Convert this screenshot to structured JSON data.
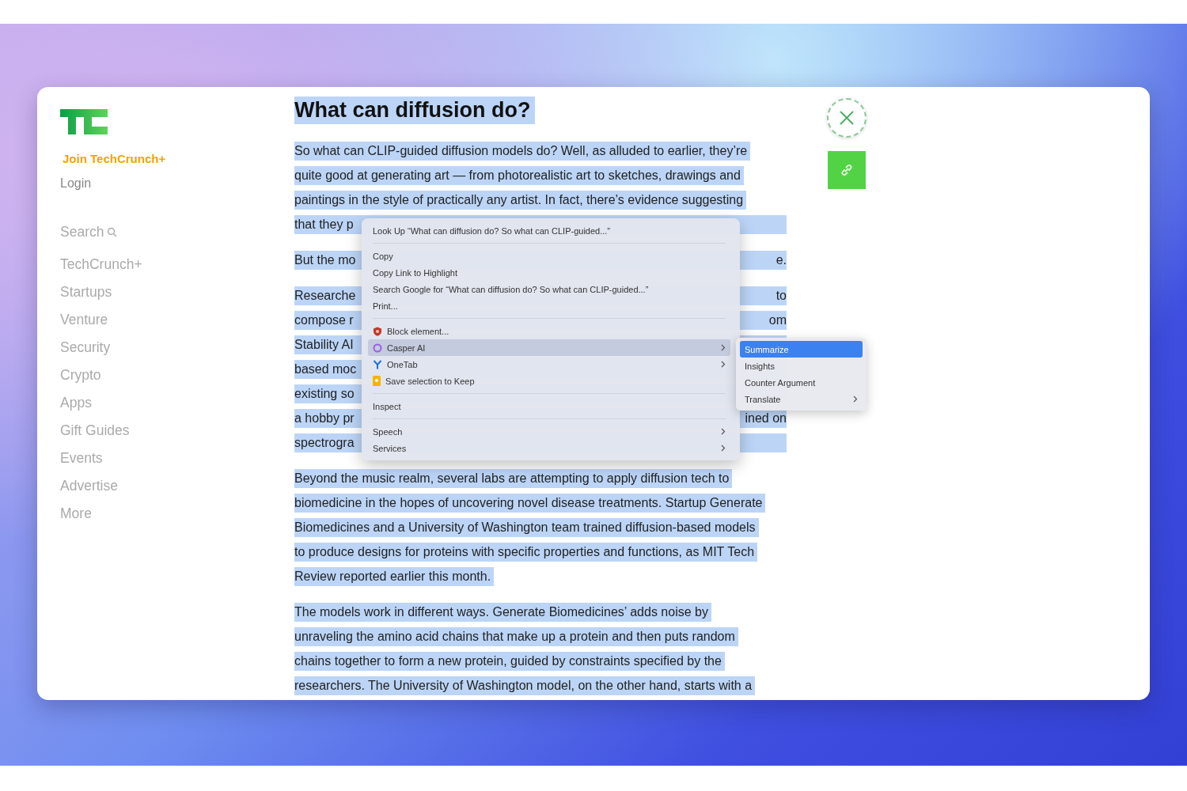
{
  "sidebar": {
    "join_link": "Join TechCrunch+",
    "login_link": "Login",
    "search_link": "Search",
    "items": [
      "TechCrunch+",
      "Startups",
      "Venture",
      "Security",
      "Crypto",
      "Apps",
      "Gift Guides",
      "Events",
      "Advertise",
      "More"
    ]
  },
  "article": {
    "heading": "What can diffusion do?",
    "paragraphs": [
      [
        {
          "kind": "full",
          "text": "So what can CLIP-guided diffusion models do? Well, as alluded to earlier, they’re"
        },
        {
          "kind": "full",
          "text": "quite good at generating art — from photorealistic art to sketches, drawings and"
        },
        {
          "kind": "full",
          "text": "paintings in the style of practically any artist. In fact, there’s evidence suggesting"
        },
        {
          "kind": "split",
          "start": "that they p"
        }
      ],
      [
        {
          "kind": "split",
          "start": "But the mo",
          "end": "e."
        }
      ],
      [
        {
          "kind": "split",
          "start": "Researche",
          "end": "to"
        },
        {
          "kind": "split",
          "start": "compose r",
          "end": "om"
        },
        {
          "kind": "split",
          "start": "Stability AI"
        },
        {
          "kind": "split",
          "start": "based moc"
        },
        {
          "kind": "split",
          "start": "existing so"
        },
        {
          "kind": "split",
          "start": "a hobby pr",
          "end": "ined on"
        },
        {
          "kind": "split",
          "start": "spectrogra"
        }
      ],
      [
        {
          "kind": "full",
          "text": "Beyond the music realm, several labs are attempting to apply diffusion tech to"
        },
        {
          "kind": "full",
          "text": "biomedicine in the hopes of uncovering novel disease treatments. Startup Generate"
        },
        {
          "kind": "full",
          "text": "Biomedicines and a University of Washington team trained diffusion-based models"
        },
        {
          "kind": "full",
          "text": "to produce designs for proteins with specific properties and functions, as MIT Tech"
        },
        {
          "kind": "full",
          "text": "Review reported earlier this month."
        }
      ],
      [
        {
          "kind": "full",
          "text": "The models work in different ways. Generate Biomedicines’ adds noise by"
        },
        {
          "kind": "full",
          "text": "unraveling the amino acid chains that make up a protein and then puts random"
        },
        {
          "kind": "full",
          "text": "chains together to form a new protein, guided by constraints specified by the"
        },
        {
          "kind": "full",
          "text": "researchers. The University of Washington model, on the other hand, starts with a"
        }
      ]
    ]
  },
  "context_menu": {
    "groups": [
      [
        {
          "label": "Look Up “What can diffusion do? So what can CLIP-guided...”",
          "selected": false,
          "has_submenu": false
        }
      ],
      [
        {
          "label": "Copy",
          "selected": false,
          "has_submenu": false
        },
        {
          "label": "Copy Link to Highlight",
          "selected": false,
          "has_submenu": false
        },
        {
          "label": "Search Google for “What can diffusion do? So what can CLIP-guided...”",
          "selected": false,
          "has_submenu": false
        },
        {
          "label": "Print...",
          "selected": false,
          "has_submenu": false
        }
      ],
      [
        {
          "label": "Block element...",
          "kind": "shield",
          "selected": false,
          "has_submenu": false
        },
        {
          "label": "Casper AI",
          "kind": "ring",
          "selected": true,
          "has_submenu": true
        },
        {
          "label": "OneTab",
          "kind": "fork",
          "selected": false,
          "has_submenu": true
        },
        {
          "label": "Save selection to Keep",
          "kind": "note",
          "selected": false,
          "has_submenu": false
        }
      ],
      [
        {
          "label": "Inspect",
          "selected": false,
          "has_submenu": false
        }
      ],
      [
        {
          "label": "Speech",
          "selected": false,
          "has_submenu": true
        },
        {
          "label": "Services",
          "selected": false,
          "has_submenu": true
        }
      ]
    ]
  },
  "submenu": {
    "items": [
      {
        "label": "Summarize",
        "selected": true,
        "has_submenu": false
      },
      {
        "label": "Insights",
        "selected": false,
        "has_submenu": false
      },
      {
        "label": "Counter Argument",
        "selected": false,
        "has_submenu": false
      },
      {
        "label": "Translate",
        "selected": false,
        "has_submenu": true
      }
    ]
  }
}
